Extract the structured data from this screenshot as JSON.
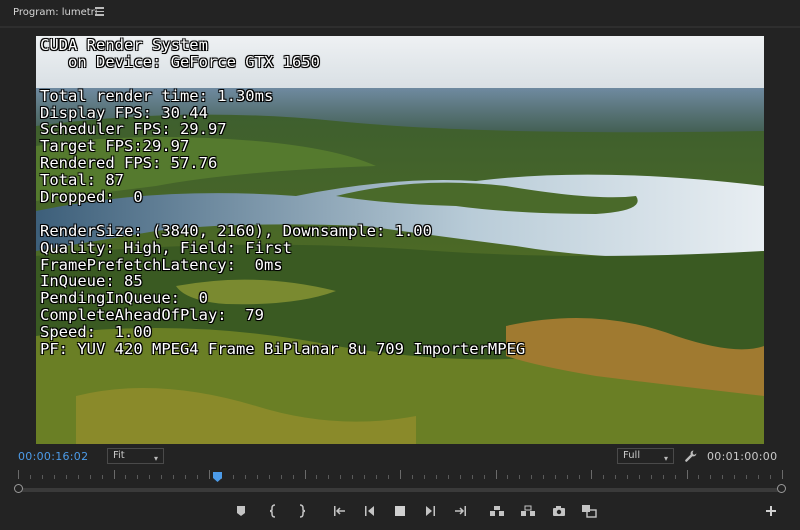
{
  "panel": {
    "title": "Program: lumetri",
    "menu_icon": "hamburger-menu-icon"
  },
  "overlay": {
    "lines": [
      "CUDA Render System",
      "   on Device: GeForce GTX 1650",
      "",
      "Total render time: 1.30ms",
      "Display FPS: 30.44",
      "Scheduler FPS: 29.97",
      "Target FPS:29.97",
      "Rendered FPS: 57.76",
      "Total: 87",
      "Dropped:  0",
      "",
      "RenderSize: (3840, 2160), Downsample: 1.00",
      "Quality: High, Field: First",
      "FramePrefetchLatency:  0ms",
      "InQueue: 85",
      "PendingInQueue:  0",
      "CompleteAheadOfPlay:  79",
      "Speed:  1.00",
      "PF: YUV 420 MPEG4 Frame BiPlanar 8u 709 ImporterMPEG"
    ]
  },
  "timecode": {
    "current": "00:00:16:02",
    "duration": "00:01:00:00"
  },
  "zoom": {
    "selected": "Fit"
  },
  "resolution": {
    "selected": "Full"
  },
  "timeline": {
    "playhead_fraction": 0.26
  },
  "colors": {
    "accent": "#4c9be8",
    "panel_bg": "#232323"
  },
  "transport": {
    "buttons": [
      "add-marker-icon",
      "mark-in-icon",
      "mark-out-icon",
      "go-to-in-icon",
      "step-back-icon",
      "stop-icon",
      "step-forward-icon",
      "go-to-out-icon",
      "lift-icon",
      "extract-icon",
      "export-frame-icon",
      "compare-view-icon",
      "add-button-icon"
    ]
  }
}
